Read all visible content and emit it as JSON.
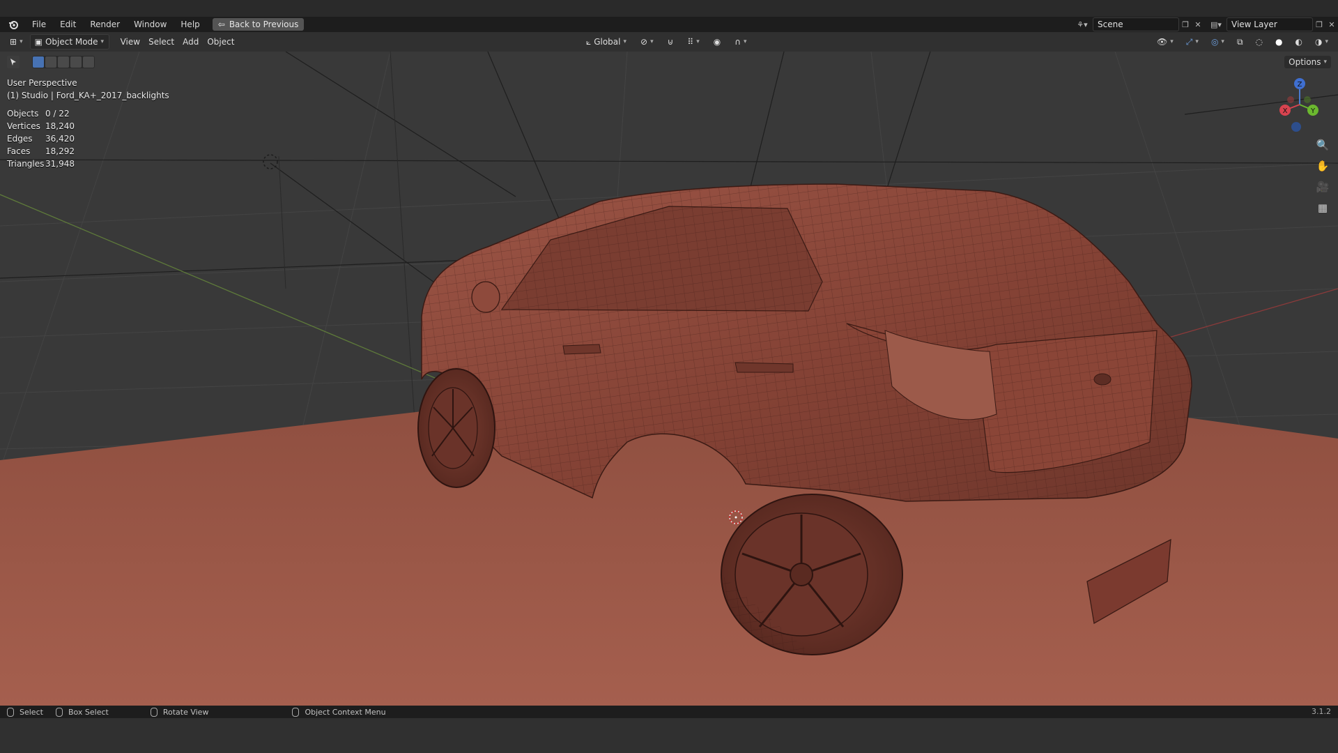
{
  "menubar": {
    "items": [
      "File",
      "Edit",
      "Render",
      "Window",
      "Help"
    ],
    "back_button": "Back to Previous",
    "scene_name": "Scene",
    "view_layer": "View Layer"
  },
  "header": {
    "mode": "Object Mode",
    "menus": [
      "View",
      "Select",
      "Add",
      "Object"
    ],
    "orientation": "Global",
    "options": "Options"
  },
  "viewport": {
    "view_name": "User Perspective",
    "collection_object": "(1) Studio | Ford_KA+_2017_backlights",
    "stats": [
      {
        "label": "Objects",
        "value": "0 / 22"
      },
      {
        "label": "Vertices",
        "value": "18,240"
      },
      {
        "label": "Edges",
        "value": "36,420"
      },
      {
        "label": "Faces",
        "value": "18,292"
      },
      {
        "label": "Triangles",
        "value": "31,948"
      }
    ],
    "gizmo": {
      "x": "X",
      "y": "Y",
      "z": "Z"
    },
    "colors": {
      "floor": "#9a5747",
      "car": "#8e4a3c",
      "background": "#393939"
    }
  },
  "statusbar": {
    "select": "Select",
    "box_select": "Box Select",
    "rotate_view": "Rotate View",
    "context_menu": "Object Context Menu",
    "version": "3.1.2"
  }
}
